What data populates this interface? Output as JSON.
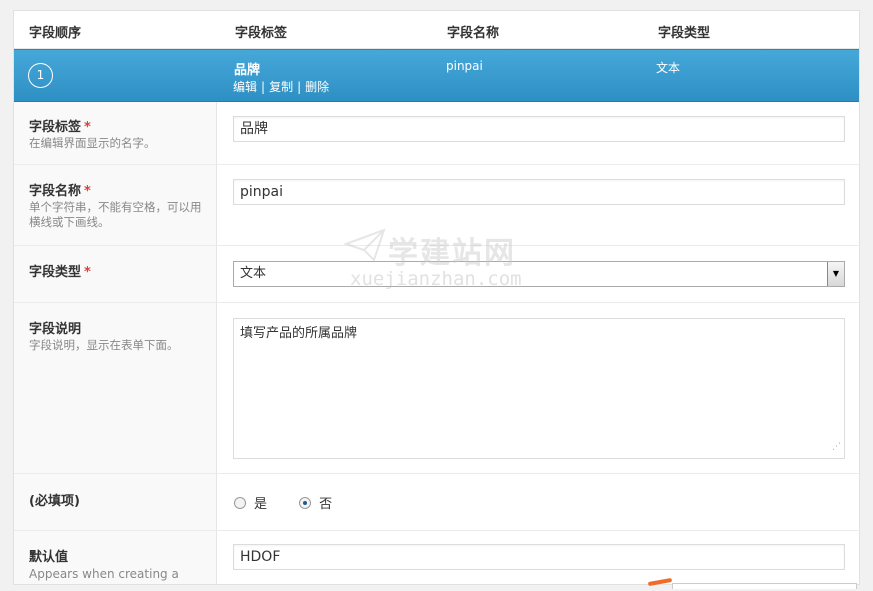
{
  "columns": [
    "字段顺序",
    "字段标签",
    "字段名称",
    "字段类型"
  ],
  "field_row": {
    "order": "1",
    "label": "品牌",
    "name": "pinpai",
    "type": "文本",
    "actions": {
      "edit": "编辑",
      "copy": "复制",
      "delete": "删除",
      "sep": "|"
    }
  },
  "required_mark": "*",
  "rows": {
    "label": {
      "title": "字段标签",
      "desc": "在编辑界面显示的名字。",
      "value": "品牌"
    },
    "name": {
      "title": "字段名称",
      "desc": "单个字符串，不能有空格，可以用横线或下画线。",
      "value": "pinpai"
    },
    "type": {
      "title": "字段类型",
      "value": "文本"
    },
    "instructions": {
      "title": "字段说明",
      "desc": "字段说明，显示在表单下面。",
      "value": "填写产品的所属品牌"
    },
    "required": {
      "title": "(必填项)",
      "options": [
        "是",
        "否"
      ],
      "selected": "否"
    },
    "default": {
      "title": "默认值",
      "desc": "Appears when creating a",
      "value": "HDOF"
    }
  },
  "watermark": {
    "cn": "学建站网",
    "en": "xuejianzhan.com"
  },
  "colors": {
    "header_blue": "#3a9bd0",
    "required_red": "#dd3d36"
  }
}
